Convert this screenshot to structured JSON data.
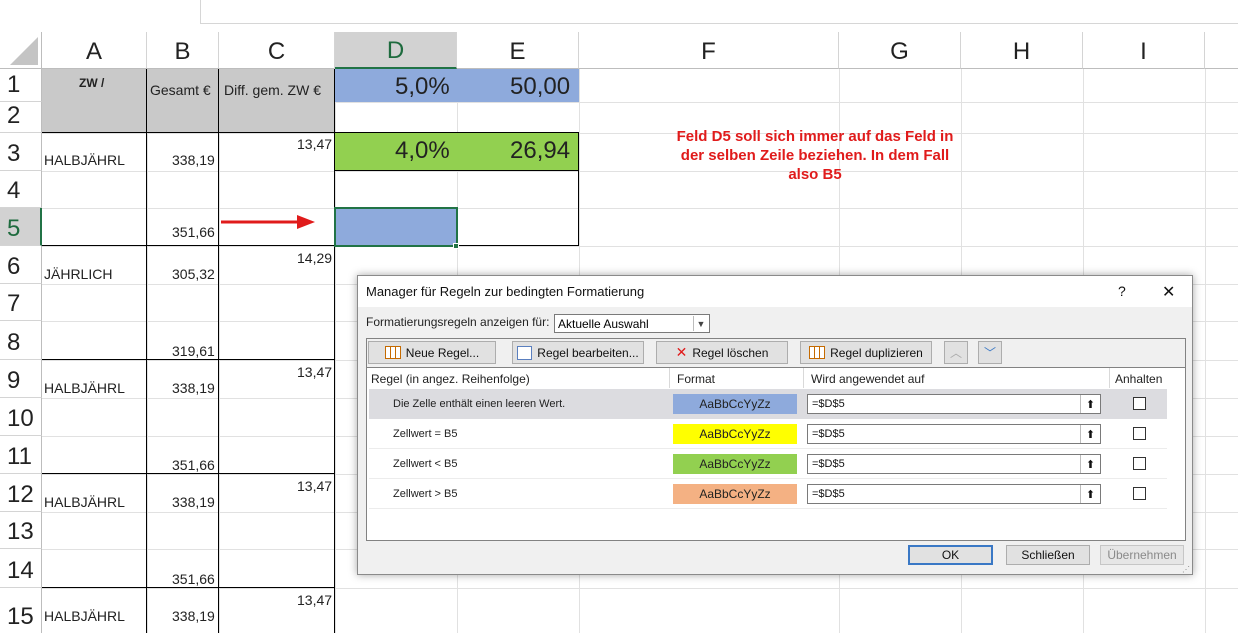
{
  "columns": [
    "A",
    "B",
    "C",
    "D",
    "E",
    "F",
    "G",
    "H",
    "I"
  ],
  "rows": [
    "1",
    "2",
    "3",
    "4",
    "5",
    "6",
    "7",
    "8",
    "9",
    "10",
    "11",
    "12",
    "13",
    "14",
    "15"
  ],
  "cells": {
    "A1": "ZW /",
    "B1": "Gesamt €",
    "C1": "Diff. gem. ZW €",
    "D1": "5,0%",
    "E1": "50,00",
    "A3": "HALBJÄHRL",
    "B3": "338,19",
    "C3": "13,47",
    "D3": "4,0%",
    "E3": "26,94",
    "B5": "351,66",
    "A6": "JÄHRLICH",
    "B6": "305,32",
    "C6": "14,29",
    "B8": "319,61",
    "A9": "HALBJÄHRL",
    "B9": "338,19",
    "C9": "13,47",
    "B11": "351,66",
    "A12": "HALBJÄHRL",
    "B12": "338,19",
    "C12": "13,47",
    "B14": "351,66",
    "A15": "HALBJÄHRL",
    "B15": "338,19",
    "C15": "13,47"
  },
  "note": {
    "line1": "Feld D5 soll sich immer auf das Feld in",
    "line2": "der selben Zeile beziehen. In dem Fall",
    "line3": "also B5"
  },
  "colors": {
    "blue": "#8eaadc",
    "green": "#92d050",
    "yellow": "#ffff00",
    "salmon": "#f4b183",
    "gray": "#c9c9c9",
    "accent": "#217346"
  },
  "dialog": {
    "title": "Manager für Regeln zur bedingten Formatierung",
    "help": "?",
    "close": "✕",
    "show_rules_label": "Formatierungsregeln anzeigen für:",
    "show_rules_value": "Aktuelle Auswahl",
    "toolbar": {
      "new": "Neue Regel...",
      "edit": "Regel bearbeiten...",
      "delete": "Regel löschen",
      "duplicate": "Regel duplizieren"
    },
    "headers": {
      "rule": "Regel (in angez. Reihenfolge)",
      "format": "Format",
      "applies": "Wird angewendet auf",
      "stop": "Anhalten"
    },
    "rules": [
      {
        "rule": "Die Zelle enthält einen leeren Wert.",
        "format": "AaBbCcYyZz",
        "applies": "=$D$5"
      },
      {
        "rule": "Zellwert = B5",
        "format": "AaBbCcYyZz",
        "applies": "=$D$5"
      },
      {
        "rule": "Zellwert < B5",
        "format": "AaBbCcYyZz",
        "applies": "=$D$5"
      },
      {
        "rule": "Zellwert > B5",
        "format": "AaBbCcYyZz",
        "applies": "=$D$5"
      }
    ],
    "ok": "OK",
    "close_btn": "Schließen",
    "apply": "Übernehmen"
  }
}
